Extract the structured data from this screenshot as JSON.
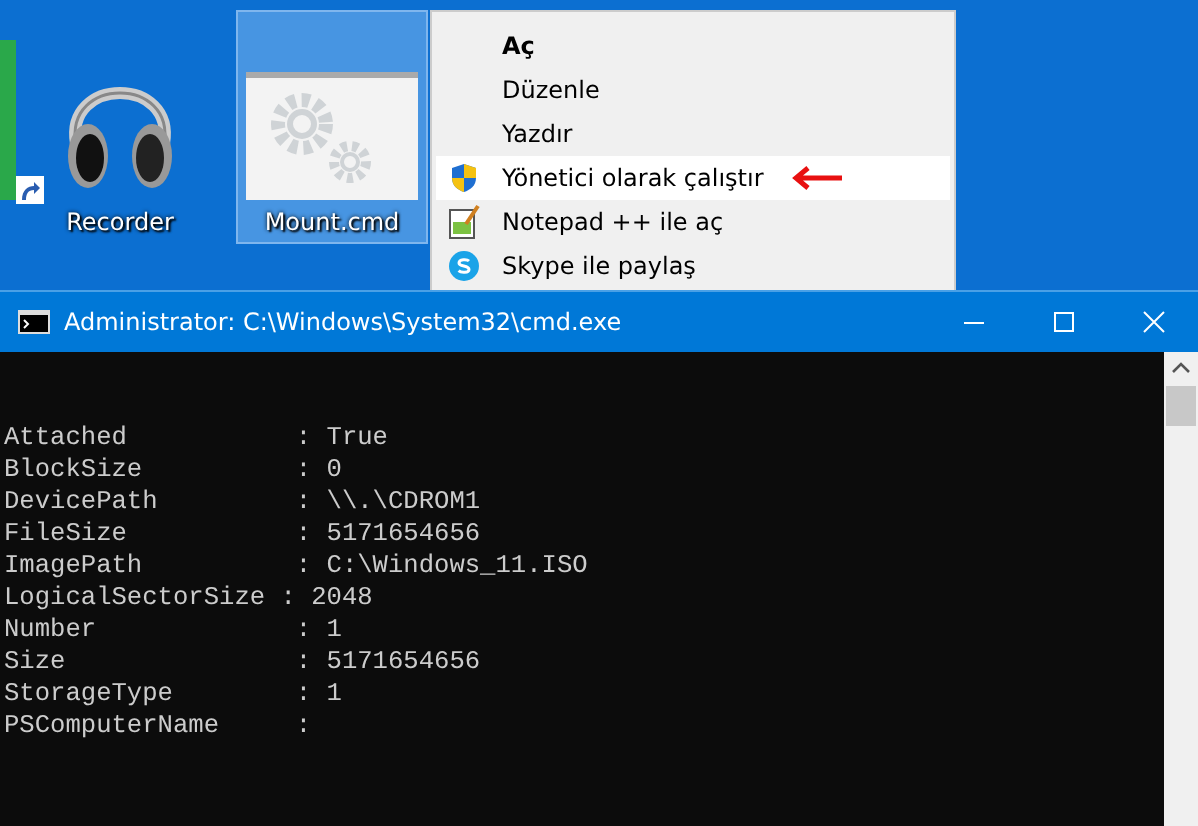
{
  "desktop": {
    "icons": [
      {
        "label": "Recorder",
        "kind": "headphones",
        "shortcut": true,
        "selected": false
      },
      {
        "label": "Mount.cmd",
        "kind": "script",
        "shortcut": false,
        "selected": true
      }
    ]
  },
  "context_menu": {
    "items": [
      {
        "label": "Aç",
        "kind": "plain",
        "bold": true,
        "selected": false,
        "marked": false
      },
      {
        "label": "Düzenle",
        "kind": "plain",
        "bold": false,
        "selected": false,
        "marked": false
      },
      {
        "label": "Yazdır",
        "kind": "plain",
        "bold": false,
        "selected": false,
        "marked": false
      },
      {
        "label": "Yönetici olarak çalıştır",
        "kind": "shield",
        "bold": false,
        "selected": true,
        "marked": true
      },
      {
        "label": "Notepad ++ ile aç",
        "kind": "notepad",
        "bold": false,
        "selected": false,
        "marked": false
      },
      {
        "label": "Skype ile paylaş",
        "kind": "skype",
        "bold": false,
        "selected": false,
        "marked": false
      }
    ]
  },
  "console_window": {
    "title": "Administrator: C:\\Windows\\System32\\cmd.exe",
    "lines": [
      "Attached           : True",
      "BlockSize          : 0",
      "DevicePath         : \\\\.\\CDROM1",
      "FileSize           : 5171654656",
      "ImagePath          : C:\\Windows_11.ISO",
      "LogicalSectorSize : 2048",
      "Number             : 1",
      "Size               : 5171654656",
      "StorageType        : 1",
      "PSComputerName     :"
    ]
  }
}
